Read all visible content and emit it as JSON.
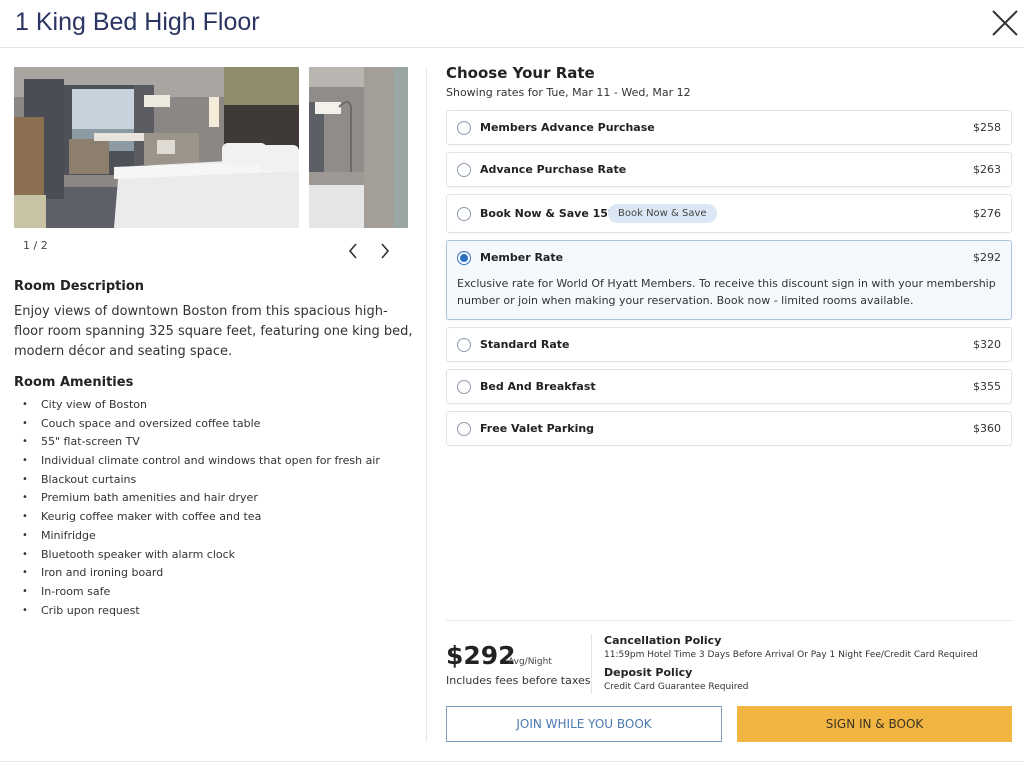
{
  "header": {
    "title": "1 King Bed High Floor",
    "close_icon": "close-icon"
  },
  "gallery": {
    "counter": "1 / 2",
    "current": 1,
    "total": 2,
    "images": [
      "hotel-room-king-bed-photo",
      "hotel-room-lamp-couch-photo"
    ],
    "prev_icon": "chevron-left-icon",
    "next_icon": "chevron-right-icon"
  },
  "room_description": {
    "title": "Room Description",
    "text": "Enjoy views of downtown Boston from this spacious high-floor room spanning 325 square feet, featuring one king bed, modern décor and seating space."
  },
  "room_amenities": {
    "title": "Room Amenities",
    "items": [
      "City view of Boston",
      "Couch space and oversized coffee table",
      "55\" flat-screen TV",
      "Individual climate control and windows that open for fresh air",
      "Blackout curtains",
      "Premium bath amenities and hair dryer",
      "Keurig coffee maker with coffee and tea",
      "Minifridge",
      "Bluetooth speaker with alarm clock",
      "Iron and ironing board",
      "In-room safe",
      "Crib upon request"
    ]
  },
  "rates": {
    "title": "Choose Your Rate",
    "subtitle": "Showing rates for Tue, Mar 11 - Wed, Mar 12",
    "selected_index": 3,
    "options": [
      {
        "name": "Members Advance Purchase",
        "price": "$258",
        "selected": false
      },
      {
        "name": "Advance Purchase Rate",
        "price": "$263",
        "selected": false
      },
      {
        "name": "Book Now & Save 15%",
        "price": "$276",
        "badge": "Book Now & Save",
        "selected": false
      },
      {
        "name": "Member Rate",
        "price": "$292",
        "selected": true,
        "detail": "Exclusive rate for World Of Hyatt Members. To receive this discount sign in with your membership number or join when making your reservation. Book now - limited rooms available."
      },
      {
        "name": "Standard Rate",
        "price": "$320",
        "selected": false
      },
      {
        "name": "Bed And Breakfast",
        "price": "$355",
        "selected": false
      },
      {
        "name": "Free Valet Parking",
        "price": "$360",
        "selected": false
      }
    ]
  },
  "summary": {
    "price": "$292",
    "price_unit": "Avg/Night",
    "fees_note": "Includes fees before taxes",
    "cancellation_title": "Cancellation Policy",
    "cancellation_text": "11:59pm Hotel Time 3 Days Before Arrival Or Pay 1 Night Fee/Credit Card Required",
    "deposit_title": "Deposit Policy",
    "deposit_text": "Credit Card Guarantee Required"
  },
  "actions": {
    "join_label": "JOIN WHILE YOU BOOK",
    "sign_in_label": "SIGN IN & BOOK"
  },
  "colors": {
    "title": "#2a3561",
    "accent_blue": "#2f6fc0",
    "selected_bg": "#f5f8fc",
    "badge_bg": "#dbe7f4",
    "primary_button": "#f2b541",
    "secondary_button_text": "#4b79b0"
  }
}
